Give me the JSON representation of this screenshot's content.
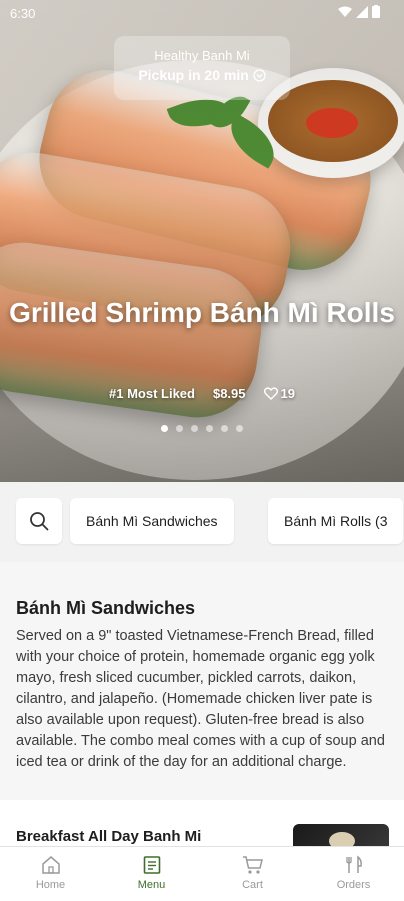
{
  "status_bar": {
    "time": "6:30"
  },
  "pickup": {
    "title": "Healthy Banh Mi",
    "subtitle": "Pickup in 20 min"
  },
  "hero": {
    "title": "Grilled Shrimp Bánh Mì Rolls",
    "badge": "#1 Most Liked",
    "price": "$8.95",
    "likes": "19",
    "page_count": 6,
    "active_page": 1
  },
  "categories": {
    "chips": [
      "Bánh Mì Sandwiches",
      "Bánh Mì Rolls (3"
    ]
  },
  "section": {
    "title": "Bánh Mì Sandwiches",
    "description": "Served on a 9\" toasted Vietnamese-French Bread, filled with your choice of protein, homemade organic egg yolk mayo, fresh sliced cucumber, pickled carrots, daikon, cilantro, and jalapeño. (Homemade chicken liver pate is also available upon request). Gluten-free bread is also available. The combo meal comes with a cup of soup and iced tea or drink of the day for an additional charge."
  },
  "item": {
    "name": "Breakfast All Day Banh Mi"
  },
  "nav": {
    "items": [
      {
        "label": "Home",
        "icon": "home-icon"
      },
      {
        "label": "Menu",
        "icon": "menu-icon"
      },
      {
        "label": "Cart",
        "icon": "cart-icon"
      },
      {
        "label": "Orders",
        "icon": "orders-icon"
      }
    ],
    "active": "Menu"
  },
  "colors": {
    "accent": "#3f6e2a",
    "nav_inactive": "#9a9a9a"
  }
}
